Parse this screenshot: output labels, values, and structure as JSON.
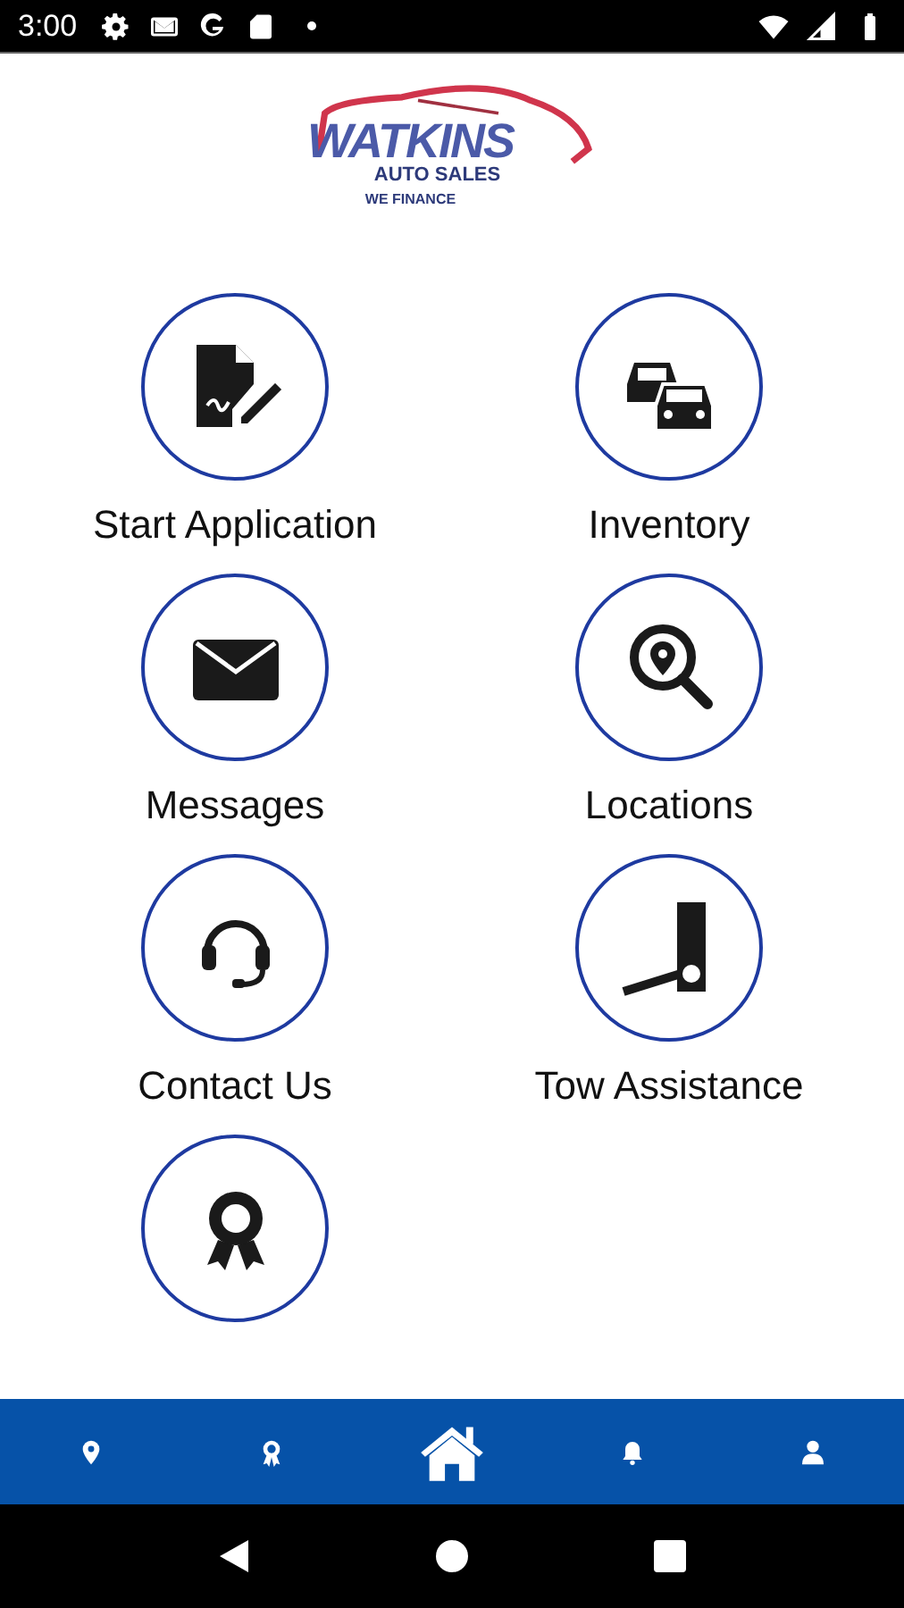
{
  "status_bar": {
    "time": "3:00"
  },
  "logo": {
    "name": "WATKINS",
    "subtitle": "AUTO SALES",
    "tagline": "WE FINANCE"
  },
  "tiles": [
    {
      "kind": "application",
      "label": "Start Application"
    },
    {
      "kind": "inventory",
      "label": "Inventory"
    },
    {
      "kind": "messages",
      "label": "Messages"
    },
    {
      "kind": "locations",
      "label": "Locations"
    },
    {
      "kind": "contact",
      "label": "Contact Us"
    },
    {
      "kind": "tow",
      "label": "Tow Assistance"
    },
    {
      "kind": "rewards"
    }
  ],
  "bottom_nav": [
    {
      "kind": "location",
      "selected": false
    },
    {
      "kind": "rewards",
      "selected": false
    },
    {
      "kind": "home",
      "selected": true
    },
    {
      "kind": "notifications",
      "selected": false
    },
    {
      "kind": "profile",
      "selected": false
    }
  ]
}
